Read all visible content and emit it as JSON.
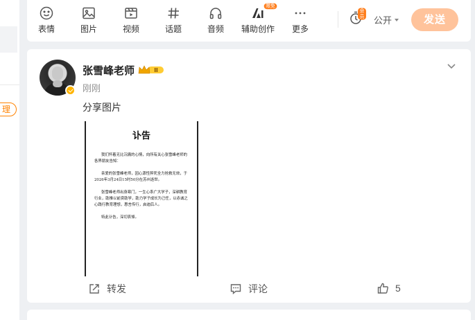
{
  "sidebar": {
    "manage_label": "理"
  },
  "toolbar": {
    "items": [
      {
        "label": "表情",
        "icon": "emoji-icon"
      },
      {
        "label": "图片",
        "icon": "image-icon"
      },
      {
        "label": "视频",
        "icon": "video-icon"
      },
      {
        "label": "话题",
        "icon": "hashtag-icon"
      },
      {
        "label": "音频",
        "icon": "audio-icon"
      },
      {
        "label": "辅助创作",
        "icon": "ai-assist-icon",
        "badge": "限免"
      },
      {
        "label": "更多",
        "icon": "more-icon"
      }
    ],
    "timer_badge": "会员",
    "visibility": "公开",
    "send_label": "发送"
  },
  "post": {
    "author": "张雪峰老师",
    "level_badge": "II",
    "time": "刚刚",
    "text": "分享图片",
    "notice": {
      "title": "讣告",
      "paragraphs": [
        "我们怀着无比沉痛的心情，向所有关心张雪峰老师的各界朋友告知：",
        "亲爱的张雪峰老师，因心源性猝死全力抢救无效，于2026年3月24日15时50分在苏州逝世。",
        "张雪峰老师出身寒门，一生心系广大学子，深耕教育行业，助推以前资助学，助力学子成长为己任，以赤诚之心践行教育理想，惠言传行，启迪后人。",
        "特此讣告，深切哀悼。"
      ]
    },
    "actions": {
      "repost": "转发",
      "comment": "评论",
      "like_count": "5"
    }
  },
  "colors": {
    "accent": "#ff8200",
    "send_disabled": "#ffc39b"
  }
}
